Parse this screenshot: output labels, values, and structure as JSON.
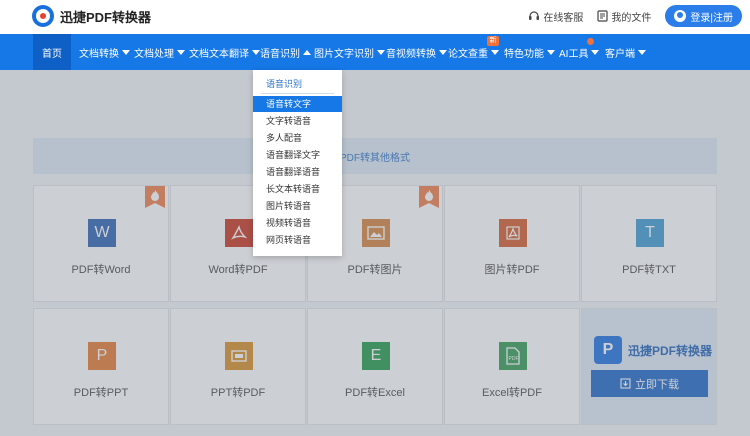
{
  "header": {
    "logo_text": "迅捷PDF转换器",
    "service_label": "在线客服",
    "files_label": "我的文件",
    "login_label": "登录|注册"
  },
  "nav": {
    "items": [
      {
        "label": "首页"
      },
      {
        "label": "文档转换"
      },
      {
        "label": "文档处理"
      },
      {
        "label": "文档文本翻译"
      },
      {
        "label": "语音识别"
      },
      {
        "label": "图片文字识别"
      },
      {
        "label": "音视频转换"
      },
      {
        "label": "论文查重"
      },
      {
        "label": "特色功能"
      },
      {
        "label": "AI工具"
      },
      {
        "label": "客户端"
      }
    ],
    "new_badge": "新"
  },
  "dropdown": {
    "title": "语音识别",
    "items": [
      "语音转文字",
      "文字转语音",
      "多人配音",
      "语音翻译文字",
      "语音翻译语音",
      "长文本转语音",
      "图片转语音",
      "视频转语音",
      "网页转语音"
    ],
    "selected": "语音转文字"
  },
  "banner": {
    "text": "PDF转其他格式"
  },
  "cards": [
    {
      "label": "PDF转Word",
      "icon": "word-icon",
      "glyph": "W",
      "color": "#2b5fb4",
      "hot": true
    },
    {
      "label": "Word转PDF",
      "icon": "pdf-icon",
      "glyph": "A",
      "color": "#c8321e",
      "hot": false
    },
    {
      "label": "PDF转图片",
      "icon": "image-icon",
      "glyph": "▲",
      "color": "#d7813a",
      "hot": true
    },
    {
      "label": "图片转PDF",
      "icon": "pdf-icon",
      "glyph": "A",
      "color": "#d35a2a",
      "hot": false
    },
    {
      "label": "PDF转TXT",
      "icon": "txt-icon",
      "glyph": "T",
      "color": "#3a9ad3",
      "hot": false
    },
    {
      "label": "PDF转PPT",
      "icon": "ppt-icon",
      "glyph": "P",
      "color": "#e6782c",
      "hot": false
    },
    {
      "label": "PPT转PDF",
      "icon": "ppt-pdf-icon",
      "glyph": "▭",
      "color": "#d98b22",
      "hot": false
    },
    {
      "label": "PDF转Excel",
      "icon": "excel-icon",
      "glyph": "E",
      "color": "#1f9a4a",
      "hot": false
    },
    {
      "label": "Excel转PDF",
      "icon": "excel-pdf-icon",
      "glyph": "PDF",
      "color": "#2f9a52",
      "hot": false
    }
  ],
  "download": {
    "brand": "迅捷PDF转换器",
    "button_label": "立即下载"
  },
  "colors": {
    "nav_bg": "#1677e6",
    "accent": "#2b7de9",
    "hot_badge": "#f07b46"
  }
}
